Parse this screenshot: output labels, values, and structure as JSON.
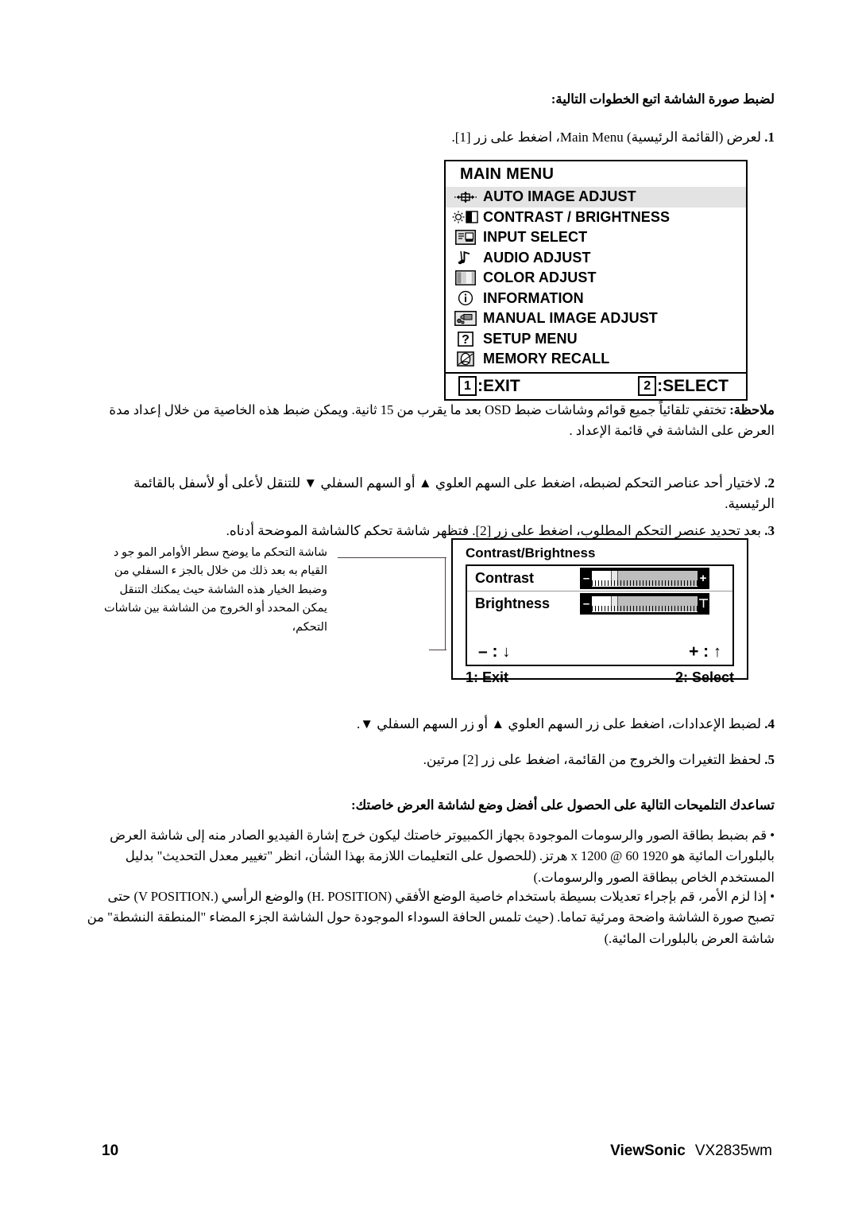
{
  "document": {
    "heading": "لضبط صورة الشاشة اتبع الخطوات التالية:",
    "page_number": "10",
    "brand": "ViewSonic",
    "model": "VX2835wm"
  },
  "steps": [
    {
      "num": "1.",
      "text": "لعرض (القائمة الرئيسية) Main Menu، اضغط على زر [1]."
    },
    {
      "num": "2.",
      "text": "لاختيار أحد عناصر التحكم لضبطه، اضغط على السهم العلوي ▲ أو السهم السفلي ▼ للتنقل لأعلى أو لأسفل بالقائمة الرئيسية."
    },
    {
      "num": "3.",
      "text": "بعد تحديد عنصر التحكم المطلوب، اضغط على زر [2]. فتظهر شاشة تحكم كالشاشة الموضحة أدناه."
    },
    {
      "num": "4.",
      "text": "لضبط الإعدادات، اضغط على زر السهم العلوي ▲ أو زر السهم السفلي ▼."
    },
    {
      "num": "5.",
      "text": "لحفظ التغيرات والخروج من القائمة، اضغط على زر [2] مرتين."
    }
  ],
  "note": {
    "label": "ملاحظة:",
    "text": "تختفي تلقائياً جميع قوائم وشاشات ضبط OSD بعد ما يقرب من 15 ثانية. ويمكن ضبط هذه الخاصية من خلال إعداد مدة العرض على الشاشة في قائمة الإعداد ."
  },
  "main_menu_osd": {
    "title": "MAIN MENU",
    "items": [
      {
        "label": "AUTO IMAGE ADJUST",
        "icon": "auto-image-adjust-icon",
        "selected": true
      },
      {
        "label": "CONTRAST / BRIGHTNESS",
        "icon": "contrast-brightness-icon",
        "selected": false
      },
      {
        "label": "INPUT SELECT",
        "icon": "input-select-icon",
        "selected": false
      },
      {
        "label": "AUDIO ADJUST",
        "icon": "audio-adjust-icon",
        "selected": false
      },
      {
        "label": "COLOR ADJUST",
        "icon": "color-adjust-icon",
        "selected": false
      },
      {
        "label": "INFORMATION",
        "icon": "information-icon",
        "selected": false
      },
      {
        "label": "MANUAL IMAGE ADJUST",
        "icon": "manual-image-adjust-icon",
        "selected": false
      },
      {
        "label": "SETUP MENU",
        "icon": "setup-menu-icon",
        "selected": false
      },
      {
        "label": "MEMORY RECALL",
        "icon": "memory-recall-icon",
        "selected": false
      }
    ],
    "footer": {
      "exit_key": "1",
      "exit_label": ":EXIT",
      "select_key": "2",
      "select_label": ":SELECT"
    },
    "selected_highlight_color": "#e3e3e3"
  },
  "contrast_brightness_osd": {
    "title": "Contrast/Brightness",
    "rows": [
      {
        "name": "Contrast",
        "minus": "–",
        "plus": "+",
        "value_percent": 18
      },
      {
        "name": "Brightness",
        "minus": "–",
        "plus": "⊤",
        "value_percent": 18
      }
    ],
    "legend": {
      "minus_label": "– :",
      "minus_arrow": "↓",
      "plus_label": "+ :",
      "plus_arrow": "↑"
    },
    "footer": {
      "exit": "1: Exit",
      "select": "2: Select"
    }
  },
  "callout": {
    "text": "شاشة التحكم ما يوضح سطر الأوامر المو جو د القيام به بعد ذلك من خلال بالجز ء السفلي من وضبط الخيار هذه الشاشة حيث يمكنك التنقل يمكن المحدد أو الخروج من الشاشة بين شاشات التحكم،"
  },
  "tips": {
    "heading": "تساعدك التلميحات التالية على الحصول على أفضل وضع لشاشة العرض خاصتك:",
    "bullets": [
      "قم بضبط بطاقة الصور والرسومات الموجودة بجهاز الكمبيوتر خاصتك ليكون خرج إشارة الفيديو الصادر منه إلى شاشة العرض بالبلورات المائية هو 1920 x 1200 @ 60 هرتز. (للحصول على التعليمات اللازمة بهذا الشأن، انظر \"تغيير معدل التحديث\" بدليل المستخدم الخاص ببطاقة الصور والرسومات.)",
      "إذا لزم الأمر، قم بإجراء تعديلات بسيطة باستخدام خاصية الوضع الأفقي (H. POSITION) والوضع الرأسي (.V POSITION) حتى تصبح صورة الشاشة واضحة ومرئية تماما. (حيث تلمس الحافة السوداء الموجودة حول الشاشة الجزء المضاء \"المنطقة النشطة\" من شاشة العرض بالبلورات المائية.)"
    ],
    "bullet_marker": "•"
  }
}
